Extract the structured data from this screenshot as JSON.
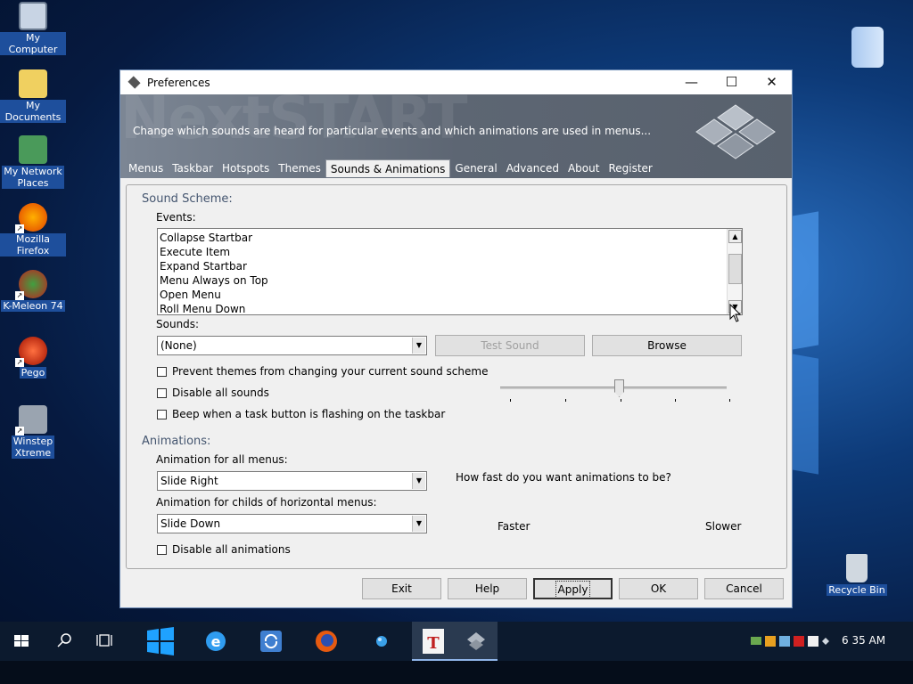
{
  "desktop": {
    "icons": [
      {
        "label": "My Computer"
      },
      {
        "label": "My Documents"
      },
      {
        "label_line1": "My Network",
        "label_line2": "Places"
      },
      {
        "label": "Mozilla Firefox"
      },
      {
        "label": "K-Meleon 74"
      },
      {
        "label": "Pego"
      },
      {
        "label_line1": "Winstep",
        "label_line2": "Xtreme"
      },
      {
        "label": "Recycle Bin"
      }
    ]
  },
  "window": {
    "title": "Preferences",
    "controls": {
      "minimize": "—",
      "maximize": "☐",
      "close": "✕"
    },
    "banner": {
      "watermark": "NextSTART",
      "caption": "Change which sounds are heard for particular events and which animations are used in menus..."
    },
    "tabs": [
      "Menus",
      "Taskbar",
      "Hotspots",
      "Themes",
      "Sounds & Animations",
      "General",
      "Advanced",
      "About",
      "Register"
    ],
    "active_tab": "Sounds & Animations"
  },
  "sound": {
    "group_title": "Sound Scheme:",
    "events_label": "Events:",
    "events": [
      "Collapse Startbar",
      "Execute Item",
      "Expand Startbar",
      "Menu Always on Top",
      "Open Menu",
      "Roll Menu Down"
    ],
    "sounds_label": "Sounds:",
    "sound_value": "(None)",
    "test_sound": "Test Sound",
    "browse": "Browse",
    "checks": [
      "Prevent themes from changing your current sound scheme",
      "Disable all sounds",
      "Beep when a task button is flashing on the taskbar"
    ]
  },
  "animations": {
    "group_title": "Animations:",
    "all_menus_label": "Animation for all menus:",
    "all_menus_value": "Slide Right",
    "childs_label": "Animation for childs of horizontal menus:",
    "childs_value": "Slide Down",
    "disable_all": "Disable all animations",
    "speed_question": "How fast do you want animations to be?",
    "faster": "Faster",
    "slower": "Slower",
    "speed_position": 0.5
  },
  "buttons": {
    "exit": "Exit",
    "help": "Help",
    "apply": "Apply",
    "ok": "OK",
    "cancel": "Cancel"
  },
  "taskbar": {
    "time": "6 35 AM"
  }
}
